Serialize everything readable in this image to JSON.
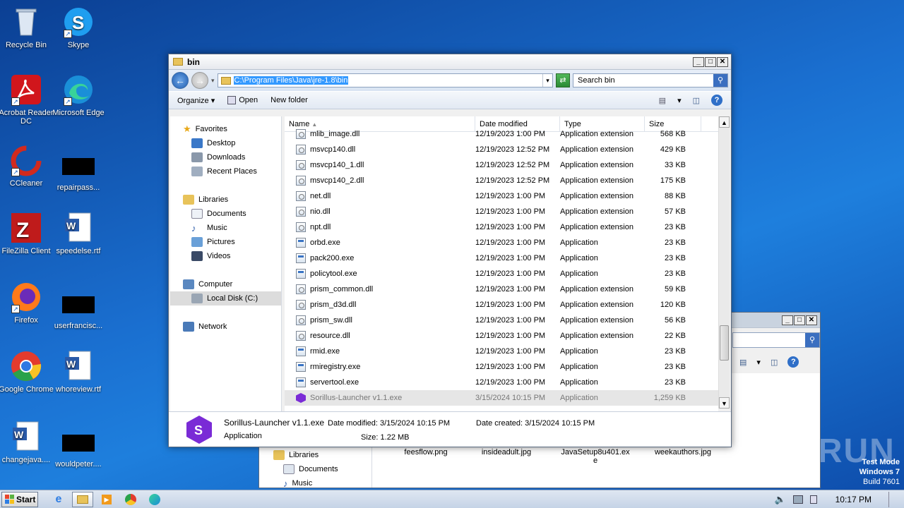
{
  "desktop": {
    "icons": [
      {
        "label": "Recycle Bin",
        "icon": "recycle-bin-icon"
      },
      {
        "label": "Skype",
        "icon": "skype-icon"
      },
      {
        "label": "Acrobat Reader DC",
        "icon": "acrobat-icon"
      },
      {
        "label": "Microsoft Edge",
        "icon": "edge-icon"
      },
      {
        "label": "CCleaner",
        "icon": "ccleaner-icon"
      },
      {
        "label": "repairpass...",
        "icon": "redacted-icon"
      },
      {
        "label": "FileZilla Client",
        "icon": "filezilla-icon"
      },
      {
        "label": "speedelse.rtf",
        "icon": "word-doc-icon"
      },
      {
        "label": "Firefox",
        "icon": "firefox-icon"
      },
      {
        "label": "userfrancisc...",
        "icon": "redacted-icon"
      },
      {
        "label": "Google Chrome",
        "icon": "chrome-icon"
      },
      {
        "label": "whoreview.rtf",
        "icon": "word-doc-icon"
      },
      {
        "label": "changejava....",
        "icon": "word-doc-icon"
      },
      {
        "label": "wouldpeter....",
        "icon": "redacted-icon"
      }
    ],
    "watermark": "ANY RUN",
    "test_mode": {
      "line1": "Test Mode",
      "line2": "Windows 7",
      "line3": "Build 7601"
    }
  },
  "explorer": {
    "title": "bin",
    "address": "C:\\Program Files\\Java\\jre-1.8\\bin",
    "search_placeholder": "Search bin",
    "commands": {
      "organize": "Organize",
      "open": "Open",
      "new_folder": "New folder"
    },
    "nav": {
      "favorites": "Favorites",
      "desktop": "Desktop",
      "downloads": "Downloads",
      "recent": "Recent Places",
      "libraries": "Libraries",
      "documents": "Documents",
      "music": "Music",
      "pictures": "Pictures",
      "videos": "Videos",
      "computer": "Computer",
      "local_disk": "Local Disk (C:)",
      "network": "Network"
    },
    "columns": {
      "name": "Name",
      "date": "Date modified",
      "type": "Type",
      "size": "Size"
    },
    "files": [
      {
        "name": "mlib_image.dll",
        "date": "12/19/2023 1:00 PM",
        "type": "Application extension",
        "size": "568 KB",
        "kind": "dll"
      },
      {
        "name": "msvcp140.dll",
        "date": "12/19/2023 12:52 PM",
        "type": "Application extension",
        "size": "429 KB",
        "kind": "dll"
      },
      {
        "name": "msvcp140_1.dll",
        "date": "12/19/2023 12:52 PM",
        "type": "Application extension",
        "size": "33 KB",
        "kind": "dll"
      },
      {
        "name": "msvcp140_2.dll",
        "date": "12/19/2023 12:52 PM",
        "type": "Application extension",
        "size": "175 KB",
        "kind": "dll"
      },
      {
        "name": "net.dll",
        "date": "12/19/2023 1:00 PM",
        "type": "Application extension",
        "size": "88 KB",
        "kind": "dll"
      },
      {
        "name": "nio.dll",
        "date": "12/19/2023 1:00 PM",
        "type": "Application extension",
        "size": "57 KB",
        "kind": "dll"
      },
      {
        "name": "npt.dll",
        "date": "12/19/2023 1:00 PM",
        "type": "Application extension",
        "size": "23 KB",
        "kind": "dll"
      },
      {
        "name": "orbd.exe",
        "date": "12/19/2023 1:00 PM",
        "type": "Application",
        "size": "23 KB",
        "kind": "exe"
      },
      {
        "name": "pack200.exe",
        "date": "12/19/2023 1:00 PM",
        "type": "Application",
        "size": "23 KB",
        "kind": "exe"
      },
      {
        "name": "policytool.exe",
        "date": "12/19/2023 1:00 PM",
        "type": "Application",
        "size": "23 KB",
        "kind": "exe"
      },
      {
        "name": "prism_common.dll",
        "date": "12/19/2023 1:00 PM",
        "type": "Application extension",
        "size": "59 KB",
        "kind": "dll"
      },
      {
        "name": "prism_d3d.dll",
        "date": "12/19/2023 1:00 PM",
        "type": "Application extension",
        "size": "120 KB",
        "kind": "dll"
      },
      {
        "name": "prism_sw.dll",
        "date": "12/19/2023 1:00 PM",
        "type": "Application extension",
        "size": "56 KB",
        "kind": "dll"
      },
      {
        "name": "resource.dll",
        "date": "12/19/2023 1:00 PM",
        "type": "Application extension",
        "size": "22 KB",
        "kind": "dll"
      },
      {
        "name": "rmid.exe",
        "date": "12/19/2023 1:00 PM",
        "type": "Application",
        "size": "23 KB",
        "kind": "exe"
      },
      {
        "name": "rmiregistry.exe",
        "date": "12/19/2023 1:00 PM",
        "type": "Application",
        "size": "23 KB",
        "kind": "exe"
      },
      {
        "name": "servertool.exe",
        "date": "12/19/2023 1:00 PM",
        "type": "Application",
        "size": "23 KB",
        "kind": "exe"
      },
      {
        "name": "Sorillus-Launcher v1.1.exe",
        "date": "3/15/2024 10:15 PM",
        "type": "Application",
        "size": "1,259 KB",
        "kind": "sorillus",
        "selected": true
      }
    ],
    "details": {
      "filename": "Sorillus-Launcher v1.1.exe",
      "filetype": "Application",
      "modified_label": "Date modified:",
      "modified": "3/15/2024 10:15 PM",
      "created_label": "Date created:",
      "created": "3/15/2024 10:15 PM",
      "size_label": "Size:",
      "size": "1.22 MB"
    }
  },
  "back_window": {
    "nav": {
      "libraries": "Libraries",
      "documents": "Documents",
      "music": "Music"
    },
    "files": [
      "feesflow.png",
      "insideadult.jpg",
      "JavaSetup8u401.exe",
      "weekauthors.jpg"
    ]
  },
  "taskbar": {
    "start": "Start",
    "clock": "10:17 PM"
  },
  "colors": {
    "accent": "#3399ff",
    "sorillus": "#7a2bd6"
  }
}
